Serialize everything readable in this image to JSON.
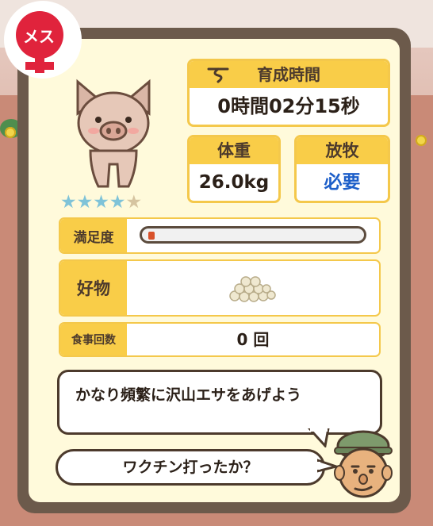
{
  "gender_badge": {
    "label": "メス",
    "color": "#e0233c",
    "icon": "female-symbol-icon"
  },
  "pig": {
    "icon": "pig-icon",
    "rating": {
      "filled": 4,
      "max": 5,
      "filled_text": "★★★★",
      "empty_text": "★"
    }
  },
  "time": {
    "label": "育成時間",
    "value": "0時間02分15秒",
    "icon": "hourglass-icon"
  },
  "weight": {
    "label": "体重",
    "value": "26.0kg"
  },
  "grazing": {
    "label": "放牧",
    "value": "必要",
    "value_color": "#1d5fc9"
  },
  "satisfaction": {
    "label": "満足度",
    "level_fraction": 0.03,
    "fill_color": "#d8512a"
  },
  "favorite": {
    "label": "好物",
    "food_icon": "beans-pile-icon"
  },
  "meals": {
    "label": "食事回数",
    "value": "0 回"
  },
  "advice": {
    "text": "かなり頻繁に沢山エサをあげよう"
  },
  "farmer_message": {
    "text": "ワクチン打ったか？",
    "icon": "farmer-face-icon"
  },
  "colors": {
    "panel_border": "#6c5a4b",
    "panel_bg": "#fffadb",
    "header_yellow": "#f9cd48"
  }
}
